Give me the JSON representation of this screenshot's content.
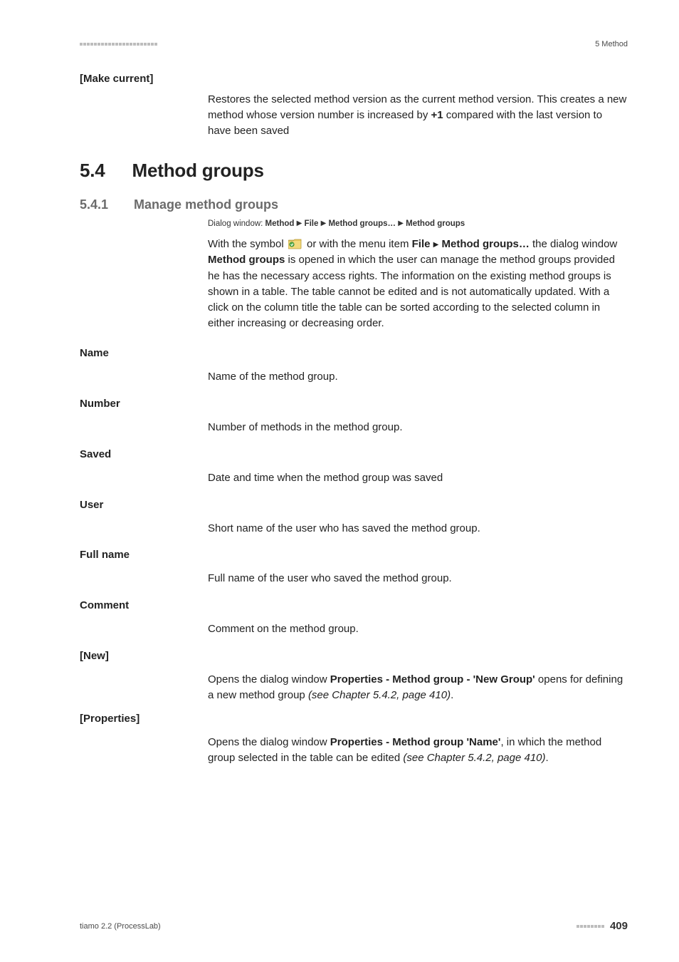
{
  "header": {
    "right": "5 Method"
  },
  "make_current": {
    "label": "[Make current]",
    "body": "Restores the selected method version as the current method version. This creates a new method whose version number is increased by ",
    "plus1": "+1",
    "body_tail": " compared with the last version to have been saved"
  },
  "section": {
    "num": "5.4",
    "title": "Method groups"
  },
  "subsection": {
    "num": "5.4.1",
    "title": "Manage method groups"
  },
  "dialog_path": {
    "prefix": "Dialog window: ",
    "p1": "Method",
    "p2": "File",
    "p3": "Method groups…",
    "p4": "Method groups"
  },
  "intro": {
    "t1": "With the symbol ",
    "t2": " or with the menu item ",
    "file": "File",
    "mg": "Method groups…",
    "t3": " the dialog window ",
    "mg2": "Method groups",
    "t4": " is opened in which the user can manage the method groups provided he has the necessary access rights. The information on the existing method groups is shown in a table. The table cannot be edited and is not automatically updated. With a click on the column title the table can be sorted according to the selected column in either increasing or decreasing order."
  },
  "defs": {
    "name": {
      "term": "Name",
      "text": "Name of the method group."
    },
    "number": {
      "term": "Number",
      "text": "Number of methods in the method group."
    },
    "saved": {
      "term": "Saved",
      "text": "Date and time when the method group was saved"
    },
    "user": {
      "term": "User",
      "text": "Short name of the user who has saved the method group."
    },
    "fullname": {
      "term": "Full name",
      "text": "Full name of the user who saved the method group."
    },
    "comment": {
      "term": "Comment",
      "text": "Comment on the method group."
    },
    "new": {
      "term": "[New]",
      "t1": "Opens the dialog window ",
      "b1": "Properties - Method group - 'New Group'",
      "t2": " opens for defining a new method group ",
      "i1": "(see Chapter 5.4.2, page 410)",
      "t3": "."
    },
    "properties": {
      "term": "[Properties]",
      "t1": "Opens the dialog window ",
      "b1": "Properties - Method group 'Name'",
      "t2": ", in which the method group selected in the table can be edited ",
      "i1": "(see Chapter 5.4.2, page 410)",
      "t3": "."
    }
  },
  "footer": {
    "left": "tiamo 2.2 (ProcessLab)",
    "page": "409"
  }
}
